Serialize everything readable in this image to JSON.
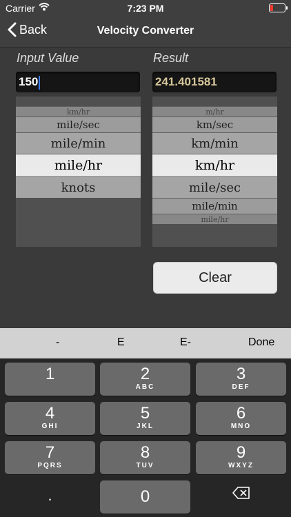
{
  "status_bar": {
    "carrier": "Carrier",
    "time": "7:23 PM"
  },
  "nav": {
    "back_label": "Back",
    "title": "Velocity Converter"
  },
  "input": {
    "label": "Input Value",
    "value": "150"
  },
  "result": {
    "label": "Result",
    "value": "241.401581"
  },
  "input_picker": {
    "items": [
      "km/hr",
      "mile/sec",
      "mile/min",
      "mile/hr",
      "knots"
    ],
    "selected": "mile/hr"
  },
  "result_picker": {
    "items": [
      "m/hr",
      "km/sec",
      "km/min",
      "km/hr",
      "mile/sec",
      "mile/min",
      "mile/hr"
    ],
    "selected": "km/hr"
  },
  "clear_button": {
    "label": "Clear"
  },
  "keyboard_toolbar": {
    "minus": "-",
    "e": "E",
    "e_minus": "E-",
    "done": "Done"
  },
  "keypad": {
    "k1": {
      "num": "1",
      "letters": ""
    },
    "k2": {
      "num": "2",
      "letters": "ABC"
    },
    "k3": {
      "num": "3",
      "letters": "DEF"
    },
    "k4": {
      "num": "4",
      "letters": "GHI"
    },
    "k5": {
      "num": "5",
      "letters": "JKL"
    },
    "k6": {
      "num": "6",
      "letters": "MNO"
    },
    "k7": {
      "num": "7",
      "letters": "PQRS"
    },
    "k8": {
      "num": "8",
      "letters": "TUV"
    },
    "k9": {
      "num": "9",
      "letters": "WXYZ"
    },
    "k0": {
      "num": "0"
    },
    "decimal": "."
  },
  "colors": {
    "background": "#3a3a3a",
    "result_text": "#d7c79a",
    "caret": "#3a7cff",
    "battery_low": "#ff3b30"
  }
}
